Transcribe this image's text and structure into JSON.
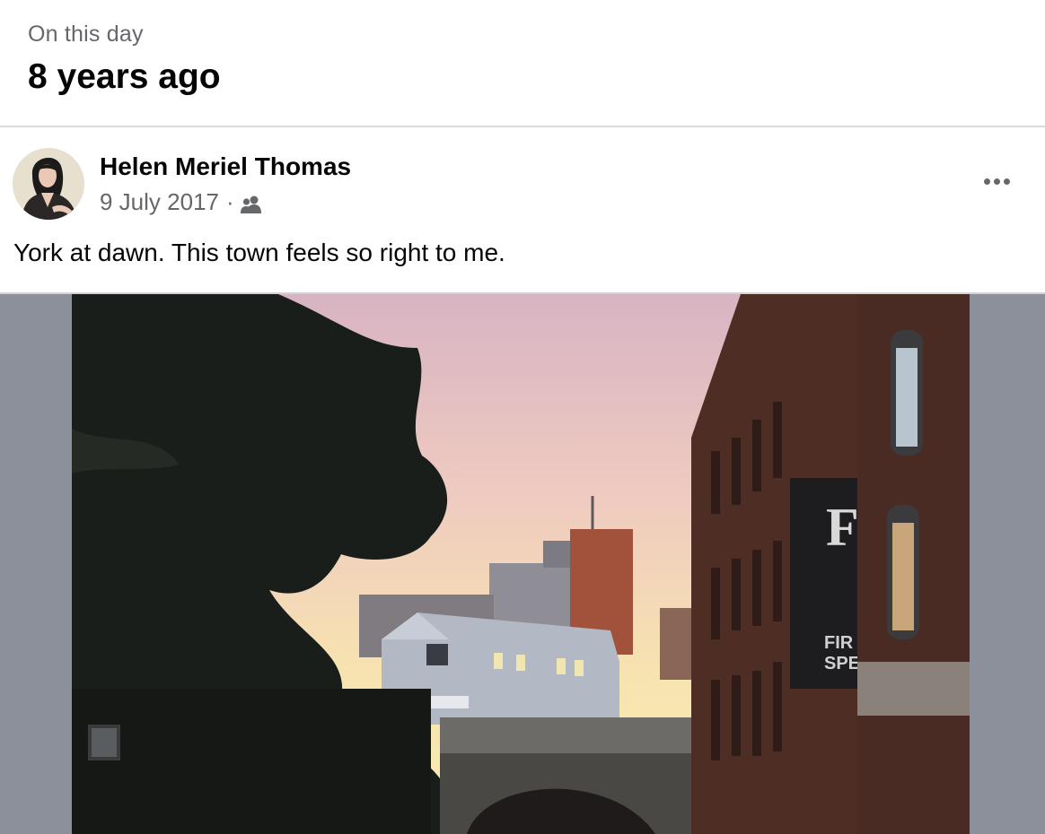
{
  "memory": {
    "kicker": "On this day",
    "title": "8 years ago"
  },
  "post": {
    "author": "Helen Meriel Thomas",
    "date": "9 July 2017",
    "separator": "·",
    "audience_icon": "friends-icon",
    "more_icon": "more-options-icon",
    "text": "York at dawn. This town feels so right to me.",
    "photo_sign_letters": "F",
    "photo_sign_lines": [
      "FIR",
      "SPE"
    ],
    "colors": {
      "sky_top": "#d9b9c6",
      "sky_bottom": "#f8e8a8",
      "brick": "#5a3128"
    }
  }
}
